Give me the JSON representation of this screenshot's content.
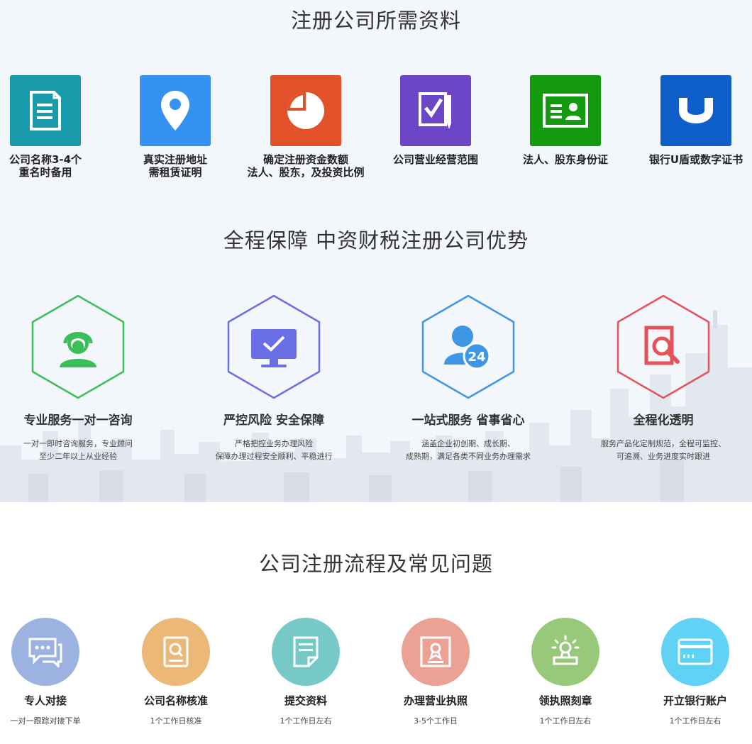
{
  "section_requirements": {
    "title": "注册公司所需资料",
    "items": [
      {
        "label": "公司名称3-4个\n重名时备用",
        "icon": "document-icon",
        "color": "#1a9bab"
      },
      {
        "label": "真实注册地址\n需租赁证明",
        "icon": "location-pin-icon",
        "color": "#3592f3"
      },
      {
        "label": "确定注册资金数额\n法人、股东，及投资比例",
        "icon": "pie-chart-icon",
        "color": "#e1512a"
      },
      {
        "label": "公司营业经营范围",
        "icon": "checklist-icon",
        "color": "#6c45c7"
      },
      {
        "label": "法人、股东身份证",
        "icon": "id-card-icon",
        "color": "#149a0f"
      },
      {
        "label": "银行U盾或数字证书",
        "icon": "u-key-icon",
        "color": "#0f5fcb"
      }
    ]
  },
  "section_advantages": {
    "title": "全程保障 中资财税注册公司优势",
    "items": [
      {
        "title": "专业服务一对一咨询",
        "desc": "一对一即时咨询服务，专业顾问\n至少二年以上从业经验",
        "icon": "consultant-icon",
        "color": "#3cbf5a"
      },
      {
        "title": "严控风险 安全保障",
        "desc": "严格把控业务办理风险\n保障办理过程安全顺利、平稳进行",
        "icon": "monitor-check-icon",
        "color": "#6a6fe8"
      },
      {
        "title": "一站式服务 省事省心",
        "desc": "涵盖企业初创期、成长期、\n成熟期，满足各类不同业务办理需求",
        "icon": "user-24-icon",
        "color": "#3d97e5"
      },
      {
        "title": "全程化透明",
        "desc": "服务产品化定制规范，全程可监控、\n可追溯、业务进度实时跟进",
        "icon": "document-search-icon",
        "color": "#e5525a"
      }
    ]
  },
  "section_process": {
    "title": "公司注册流程及常见问题",
    "items": [
      {
        "title": "专人对接",
        "desc": "一对一跟踪对接下单",
        "icon": "chat-icon",
        "color": "#9cb3e2"
      },
      {
        "title": "公司名称核准",
        "desc": "1个工作日核准",
        "icon": "search-doc-icon",
        "color": "#ebb878"
      },
      {
        "title": "提交资料",
        "desc": "1个工作日左右",
        "icon": "file-icon",
        "color": "#77c9c8"
      },
      {
        "title": "办理营业执照",
        "desc": "3-5个工作日",
        "icon": "license-icon",
        "color": "#eca195"
      },
      {
        "title": "领执照刻章",
        "desc": "1个工作日左右",
        "icon": "stamp-icon",
        "color": "#98c97a"
      },
      {
        "title": "开立银行账户",
        "desc": "1个工作日左右",
        "icon": "bank-card-icon",
        "color": "#5fd2f5"
      }
    ]
  }
}
